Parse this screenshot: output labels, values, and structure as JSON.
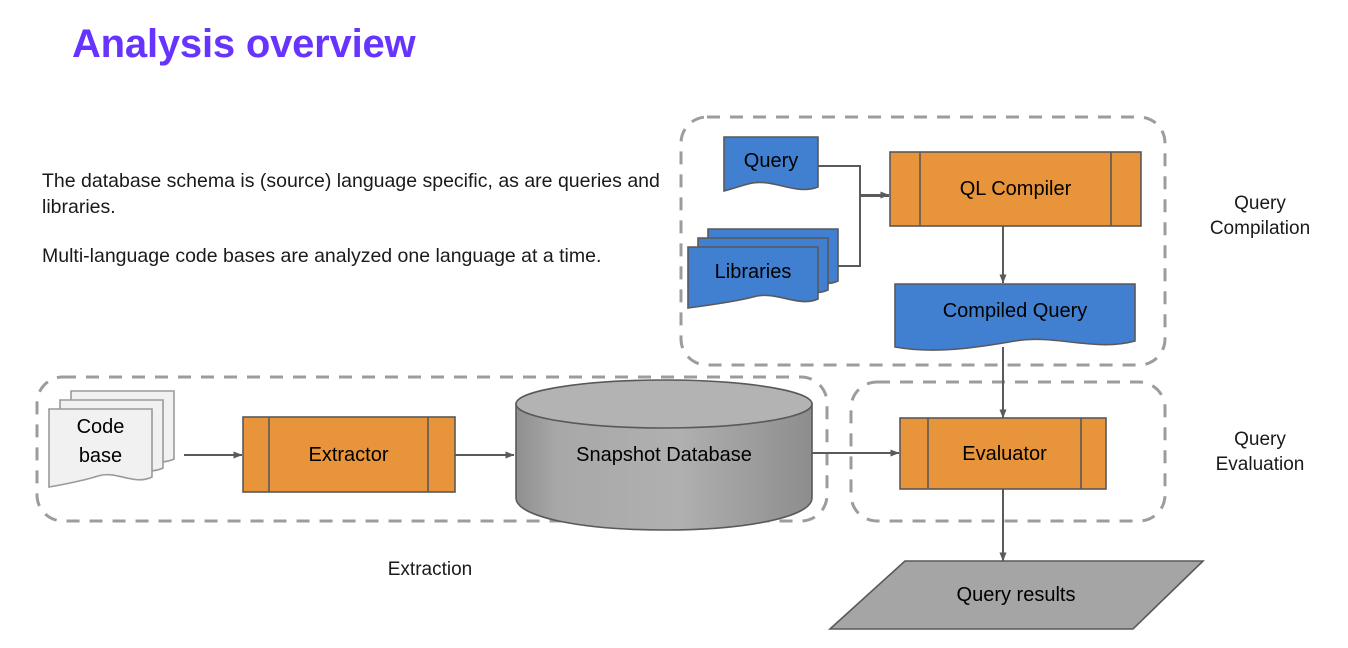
{
  "slide": {
    "title": "Analysis overview",
    "title_color": "#6633ff",
    "background": "#ffffff",
    "paragraphs": [
      "The database schema is (source) language specific, as are queries and libraries.",
      "Multi-language code bases are analyzed one language at a time."
    ]
  },
  "palette": {
    "blue_fill": "#4180d0",
    "orange_fill": "#e8943a",
    "gray_fill": "#a5a5a5",
    "light_fill": "#f1f1f1",
    "stroke": "#595959",
    "dashed_stroke": "#9c9c9c",
    "arrow_stroke": "#5a5a5a",
    "text": "#000000"
  },
  "groups": [
    {
      "id": "query-compilation",
      "label": "Query\nCompilation",
      "label_position": "right"
    },
    {
      "id": "extraction",
      "label": "Extraction",
      "label_position": "bottom"
    },
    {
      "id": "query-evaluation",
      "label": "Query\nEvaluation",
      "label_position": "right"
    }
  ],
  "nodes": [
    {
      "id": "query",
      "label": "Query",
      "shape": "document",
      "fill": "#4180d0",
      "group": "query-compilation"
    },
    {
      "id": "libraries",
      "label": "Libraries",
      "shape": "multi-document",
      "fill": "#4180d0",
      "group": "query-compilation"
    },
    {
      "id": "ql-compiler",
      "label": "QL Compiler",
      "shape": "predefined-process",
      "fill": "#e8943a",
      "group": "query-compilation"
    },
    {
      "id": "compiled-query",
      "label": "Compiled Query",
      "shape": "document",
      "fill": "#4180d0",
      "group": "query-compilation"
    },
    {
      "id": "code-base",
      "label": "Code\nbase",
      "shape": "multi-document",
      "fill": "#f1f1f1",
      "group": "extraction"
    },
    {
      "id": "extractor",
      "label": "Extractor",
      "shape": "predefined-process",
      "fill": "#e8943a",
      "group": "extraction"
    },
    {
      "id": "snapshot-database",
      "label": "Snapshot Database",
      "shape": "cylinder",
      "fill": "#a5a5a5",
      "group": "extraction"
    },
    {
      "id": "evaluator",
      "label": "Evaluator",
      "shape": "predefined-process",
      "fill": "#e8943a",
      "group": "query-evaluation"
    },
    {
      "id": "query-results",
      "label": "Query results",
      "shape": "parallelogram",
      "fill": "#a5a5a5",
      "group": null
    }
  ],
  "edges": [
    {
      "from": "query",
      "to": "ql-compiler"
    },
    {
      "from": "libraries",
      "to": "ql-compiler"
    },
    {
      "from": "ql-compiler",
      "to": "compiled-query"
    },
    {
      "from": "compiled-query",
      "to": "evaluator"
    },
    {
      "from": "code-base",
      "to": "extractor"
    },
    {
      "from": "extractor",
      "to": "snapshot-database"
    },
    {
      "from": "snapshot-database",
      "to": "evaluator"
    },
    {
      "from": "evaluator",
      "to": "query-results"
    }
  ]
}
